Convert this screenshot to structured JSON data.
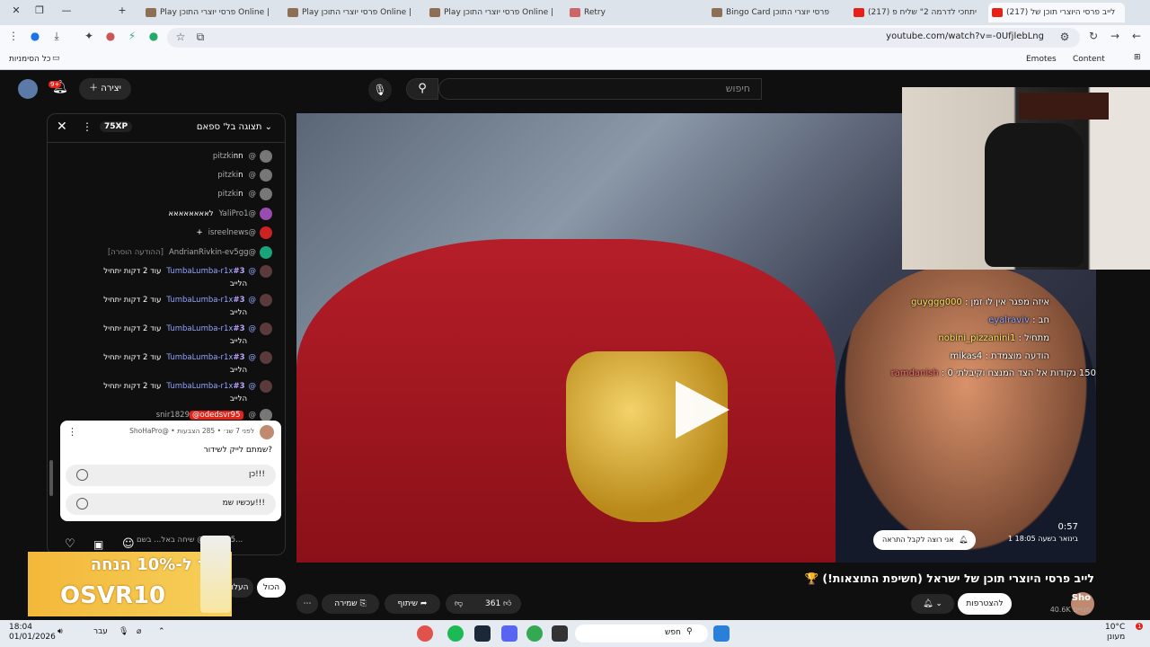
{
  "browser": {
    "tabs": [
      {
        "label": "(217) לייב פרסי היוצרי תוכן של",
        "active": true
      },
      {
        "label": "(217) יתחכי לדרמה 2\" שליח פ"
      },
      {
        "label": "Bingo Card פרסי יוצרי התוכן"
      },
      {
        "label": "Retry"
      },
      {
        "label": "Play פרסי יוצרי התוכן Online |"
      },
      {
        "label": "Play פרסי יוצרי התוכן Online |"
      },
      {
        "label": "Play פרסי יוצרי התוכן Online |"
      }
    ],
    "url": "youtube.com/watch?v=-0UfjlebLng",
    "bookmarks": {
      "all": "כל הסימניות",
      "content": "Content",
      "emotes": "Emotes"
    }
  },
  "yt_header": {
    "search_placeholder": "חיפוש",
    "create_label": "יצירה",
    "notif_count": "9+"
  },
  "chat": {
    "title": "תצוגה בל' ספאם",
    "xp": "75XP",
    "messages": [
      {
        "user": "@pitzki",
        "text": "nn"
      },
      {
        "user": "@pitzki",
        "text": "n"
      },
      {
        "user": "@pitzki",
        "text": "n"
      },
      {
        "user": "@YaliPro1",
        "text": "לאאאאאאאא"
      },
      {
        "user": "@isreelnews",
        "text": "+"
      },
      {
        "user": "@AndrianRivkin-ev5gg",
        "text": "[ההודעה הוסרה]"
      },
      {
        "user": "@TumbaLumba-r1x",
        "badge": "#3",
        "text": "עוד 2 דקות יתחיל",
        "sub": "הלייב"
      },
      {
        "user": "@TumbaLumba-r1x",
        "badge": "#3",
        "text": "עוד 2 דקות יתחיל",
        "sub": "הלייב"
      },
      {
        "user": "@TumbaLumba-r1x",
        "badge": "#3",
        "text": "עוד 2 דקות יתחיל",
        "sub": "הלייב"
      },
      {
        "user": "@TumbaLumba-r1x",
        "badge": "#3",
        "text": "עוד 2 דקות יתחיל",
        "sub": "הלייב"
      },
      {
        "user": "@TumbaLumba-r1x",
        "badge": "#3",
        "text": "עוד 2 דקות יתחיל",
        "sub": "הלייב"
      },
      {
        "user": "@snir1829",
        "text": "@odedsvr95"
      }
    ],
    "poll": {
      "meta": "ShoHaPro@ • לפני 7 שנ׳ • 285 הצבעות",
      "question": "שמתם לייק לשידור?",
      "options": [
        "כן!!!",
        "עכשיו שמ!!!"
      ]
    },
    "input_placeholder": "שיחה באל... בשם @odsvr95..."
  },
  "video": {
    "time": "0:57",
    "date": "1 בינואר בשעה 18:05",
    "notify_label": "אני רוצה לקבל התראה",
    "overlay_chat": [
      {
        "name": "guyggg000",
        "text": "איזה מפגר אין לו זמן"
      },
      {
        "name": "eyalraviv",
        "text": "חב"
      },
      {
        "name": "nobini_pizzanini1",
        "text": "מתחיל"
      },
      {
        "name": "mikas4",
        "text": "הודעה מוצמדת"
      },
      {
        "name": "ramdanish",
        "text": "150 נקודות אל הצד המנצח וקיבלתי 0"
      }
    ]
  },
  "below": {
    "title": "לייב פרסי היוצרי תוכן של ישראל (חשיפת התוצאות!) 🏆",
    "channel": "Sho",
    "subs": "40.6K מנויים",
    "subscribe": "להצטרפות",
    "likes": "361",
    "share": "שיתוף",
    "save": "שמירה",
    "filter_all": "הכול",
    "filter_other": "העלו"
  },
  "promo": {
    "line1": "קוד ל-10% הנחה",
    "line2": "OSVR10"
  },
  "taskbar": {
    "search": "חפש",
    "time": "18:04",
    "date": "01/01/2026",
    "weather_temp": "10°C",
    "weather_desc": "מעונן",
    "lang": "עבר"
  },
  "colors": {
    "accent": "#ff0000",
    "bg": "#0f0f0f",
    "badge": "#b9a6ff",
    "overlay_name": "#ffe760"
  }
}
